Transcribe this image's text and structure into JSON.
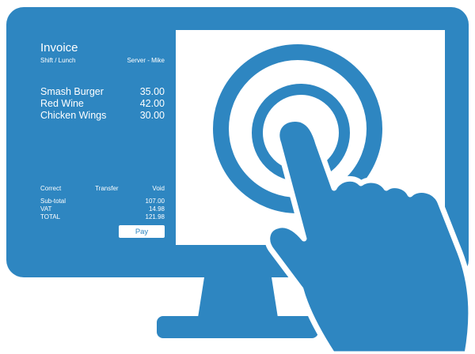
{
  "colors": {
    "primary": "#2e86c1",
    "background": "#ffffff"
  },
  "icons": [
    "monitor-icon",
    "touch-hand-icon",
    "touch-ripple-icon"
  ],
  "invoice": {
    "title": "Invoice",
    "shift": "Shift / Lunch",
    "server": "Server - Mike",
    "items": [
      {
        "name": "Smash Burger",
        "price": "35.00"
      },
      {
        "name": "Red Wine",
        "price": "42.00"
      },
      {
        "name": "Chicken Wings",
        "price": "30.00"
      }
    ],
    "actions": {
      "correct": "Correct",
      "transfer": "Transfer",
      "void": "Void"
    },
    "totals": [
      {
        "label": "Sub-total",
        "value": "107.00"
      },
      {
        "label": "VAT",
        "value": "14.98"
      },
      {
        "label": "TOTAL",
        "value": "121.98"
      }
    ],
    "pay_label": "Pay"
  }
}
